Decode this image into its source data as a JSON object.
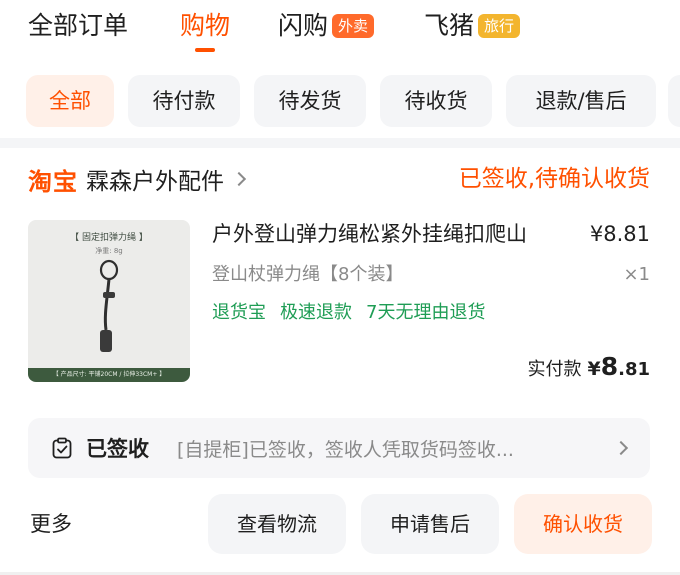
{
  "top_tabs": [
    {
      "label": "全部订单"
    },
    {
      "label": "购物",
      "active": true
    },
    {
      "label": "闪购",
      "badge": "外卖"
    },
    {
      "label": "飞猪",
      "badge": "旅行"
    }
  ],
  "filter_chips": [
    "全部",
    "待付款",
    "待发货",
    "待收货",
    "退款/售后"
  ],
  "order": {
    "platform": "淘宝",
    "shop_name": "霖森户外配件",
    "status": "已签收,待确认收货",
    "product": {
      "image_title": "【 固定扣弹力绳 】",
      "image_sub": "净重: 8g",
      "image_foot": "【 产品尺寸: 平铺20CM / 拉伸33CM+ 】",
      "title": "户外登山弹力绳松紧外挂绳扣爬山",
      "price": "¥8.81",
      "spec": "登山杖弹力绳【8个装】",
      "qty": "×1",
      "tags": [
        "退货宝",
        "极速退款",
        "7天无理由退货"
      ]
    },
    "paid": {
      "label": "实付款",
      "currency": "¥",
      "integer": "8",
      "decimal": ".81"
    },
    "logistics": {
      "icon": "delivery-check-icon",
      "status": "已签收",
      "detail": "[自提柜]已签收，签收人凭取货码签收..."
    },
    "actions": {
      "more": "更多",
      "view_logistics": "查看物流",
      "after_sale": "申请售后",
      "confirm_receipt": "确认收货"
    }
  },
  "colors": {
    "accent": "#ff5000",
    "green": "#1f9d55"
  }
}
